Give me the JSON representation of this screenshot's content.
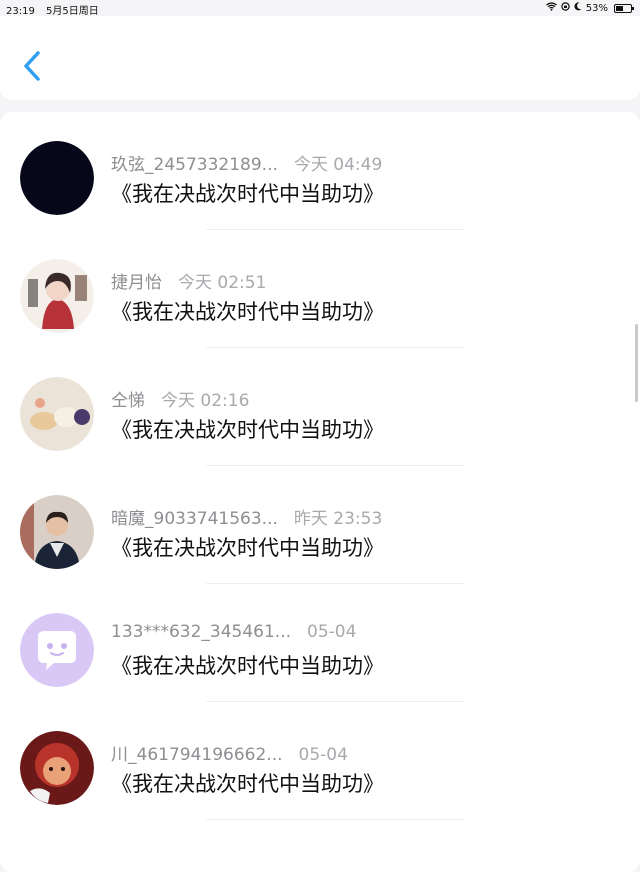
{
  "status_bar": {
    "time": "23:19",
    "date": "5月5日周日",
    "battery": "53%",
    "battery_level": 0.53
  },
  "header": {
    "back_icon": "chevron-left-icon"
  },
  "items": [
    {
      "username": "玖弦_2457332189...",
      "time": "今天 04:49",
      "title": "《我在决战次时代中当助功》",
      "avatar": "dark"
    },
    {
      "username": "捷月怡",
      "time": "今天 02:51",
      "title": "《我在决战次时代中当助功》",
      "avatar": "anime"
    },
    {
      "username": "仝悌",
      "time": "今天 02:16",
      "title": "《我在决战次时代中当助功》",
      "avatar": "photo"
    },
    {
      "username": "暗魔_9033741563...",
      "time": "昨天 23:53",
      "title": "《我在决战次时代中当助功》",
      "avatar": "person"
    },
    {
      "username": "133***632_345461...",
      "time": "05-04",
      "title": "《我在决战次时代中当助功》",
      "avatar": "default"
    },
    {
      "username": "川_461794196662...",
      "time": "05-04",
      "title": "《我在决战次时代中当助功》",
      "avatar": "cartoon"
    }
  ],
  "colors": {
    "accent": "#2f9ff3",
    "default_avatar_bg": "#d9c8f5"
  }
}
